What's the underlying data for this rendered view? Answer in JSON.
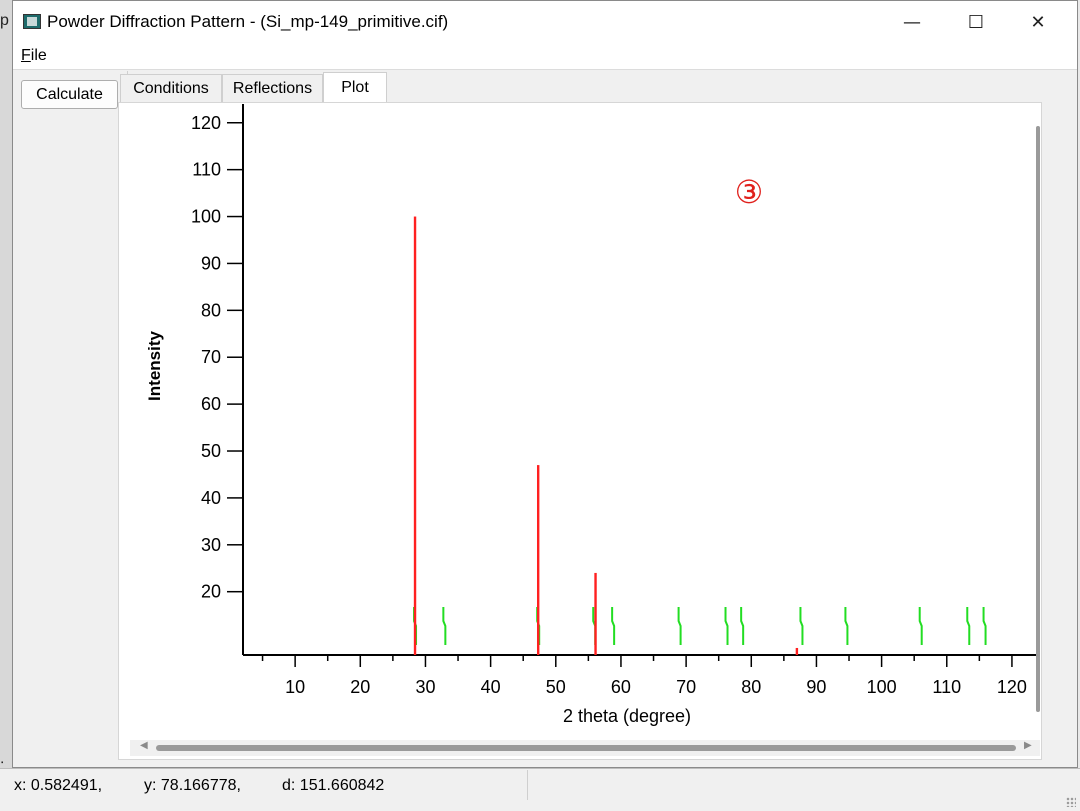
{
  "window": {
    "title": "Powder Diffraction Pattern - (Si_mp-149_primitive.cif)",
    "controls": {
      "minimize": "—",
      "maximize": "☐",
      "close": "✕"
    }
  },
  "background_fragments": {
    "left_top": "p",
    "left_bottom": ":"
  },
  "menu": {
    "file_first": "F",
    "file_rest": "ile"
  },
  "left_panel": {
    "calculate_label": "Calculate"
  },
  "tabs": [
    {
      "label": "Conditions",
      "active": false
    },
    {
      "label": "Reflections",
      "active": false
    },
    {
      "label": "Plot",
      "active": true
    }
  ],
  "annotation": {
    "text": "③",
    "color": "#e0201c"
  },
  "status": {
    "x": "x: 0.582491,",
    "y": "y: 78.166778,",
    "d": "d: 151.660842"
  },
  "colors": {
    "peak": "#ff2020",
    "tick": "#22dd22",
    "axis": "#000000"
  },
  "chart_data": {
    "type": "bar",
    "xlabel": "2 theta (degree)",
    "ylabel": "Intensity",
    "xlim": [
      2,
      124
    ],
    "ylim": [
      6.5,
      124
    ],
    "xticks_major": [
      10,
      20,
      30,
      40,
      50,
      60,
      70,
      80,
      90,
      100,
      110,
      120
    ],
    "yticks": [
      20,
      30,
      40,
      50,
      60,
      70,
      80,
      90,
      100,
      110,
      120
    ],
    "peaks": [
      {
        "x": 28.4,
        "y": 100
      },
      {
        "x": 47.3,
        "y": 47
      },
      {
        "x": 56.1,
        "y": 24
      },
      {
        "x": 87.0,
        "y": 8
      }
    ],
    "reflection_ticks": [
      28.4,
      32.9,
      47.3,
      55.9,
      58.8,
      69.0,
      76.2,
      78.6,
      87.7,
      94.6,
      106.0,
      113.3,
      115.8
    ]
  }
}
